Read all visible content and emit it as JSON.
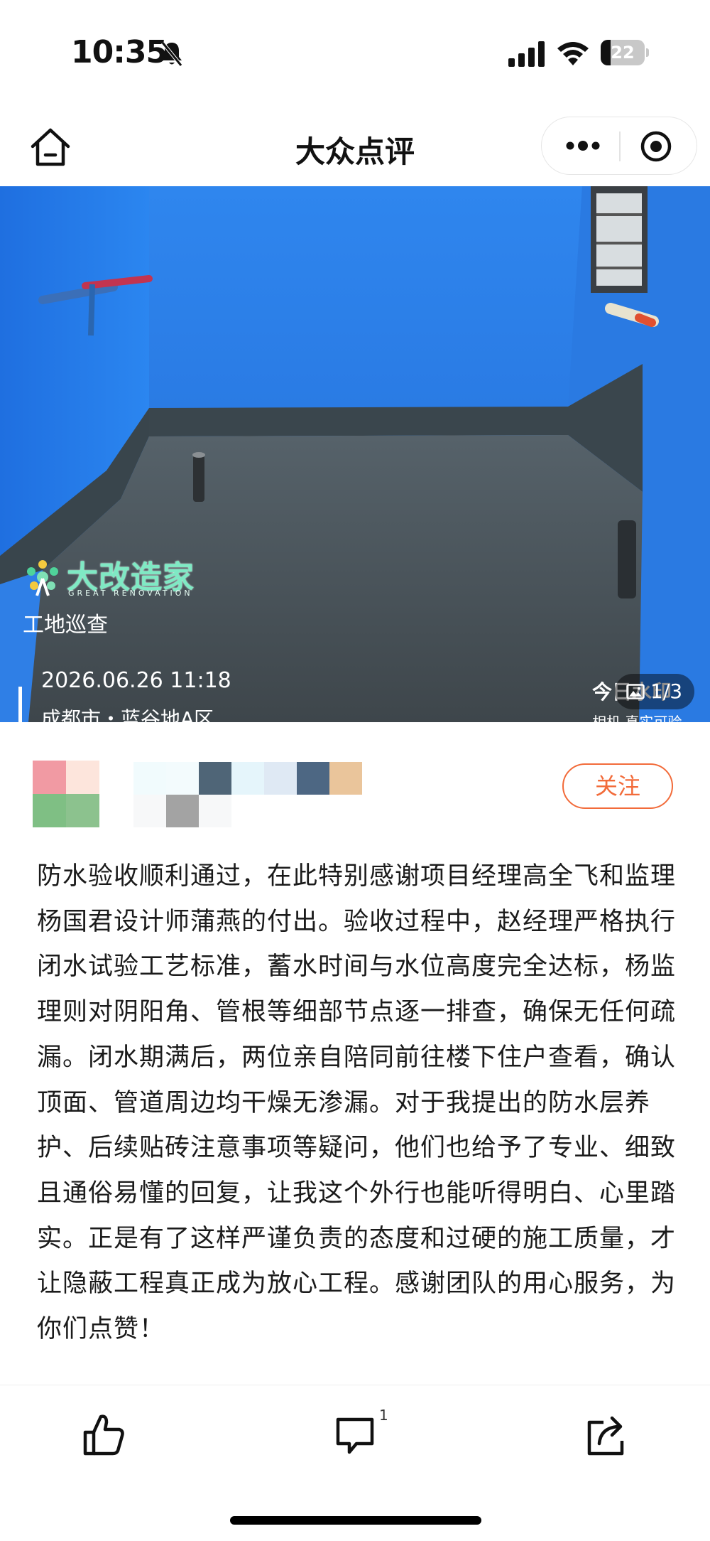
{
  "status_bar": {
    "time": "10:35",
    "battery_level": 22,
    "battery_text": "22",
    "icons": [
      "bell-muted-icon",
      "signal-icon",
      "wifi-icon",
      "battery-icon"
    ]
  },
  "nav": {
    "title": "大众点评",
    "icons": [
      "home-icon",
      "more-icon",
      "close-target-icon"
    ]
  },
  "photo": {
    "watermark": {
      "brand": "大改造家",
      "brand_sub": "GREAT RENOVATION",
      "tag": "工地巡查",
      "datetime": "2026.06.26 11:18",
      "location": "成都市・蓝谷地A区",
      "right_top": "今日水印",
      "right_bottom": "相机 真实可验"
    },
    "counter": "1/3",
    "colors": {
      "wall": "#2f7fe6",
      "floor": "#4a5358"
    }
  },
  "author": {
    "follow_label": "关注",
    "accent_color": "#f26b3a"
  },
  "review": {
    "text": "防水验收顺利通过，在此特别感谢项目经理高全飞和监理杨国君设计师蒲燕的付出。验收过程中，赵经理严格执行闭水试验工艺标准，蓄水时间与水位高度完全达标，杨监理则对阴阳角、管根等细部节点逐一排查，确保无任何疏漏。闭水期满后，两位亲自陪同前往楼下住户查看，确认顶面、管道周边均干燥无渗漏。对于我提出的防水层养护、后续贴砖注意事项等疑问，他们也给予了专业、细致且通俗易懂的回复，让我这个外行也能听得明白、心里踏实。正是有了这样严谨负责的态度和过硬的施工质量，才让隐蔽工程真正成为放心工程。感谢团队的用心服务，为你们点赞！"
  },
  "actions": {
    "comment_count": "1",
    "icons": [
      "thumbs-up-icon",
      "comment-icon",
      "share-icon"
    ]
  }
}
